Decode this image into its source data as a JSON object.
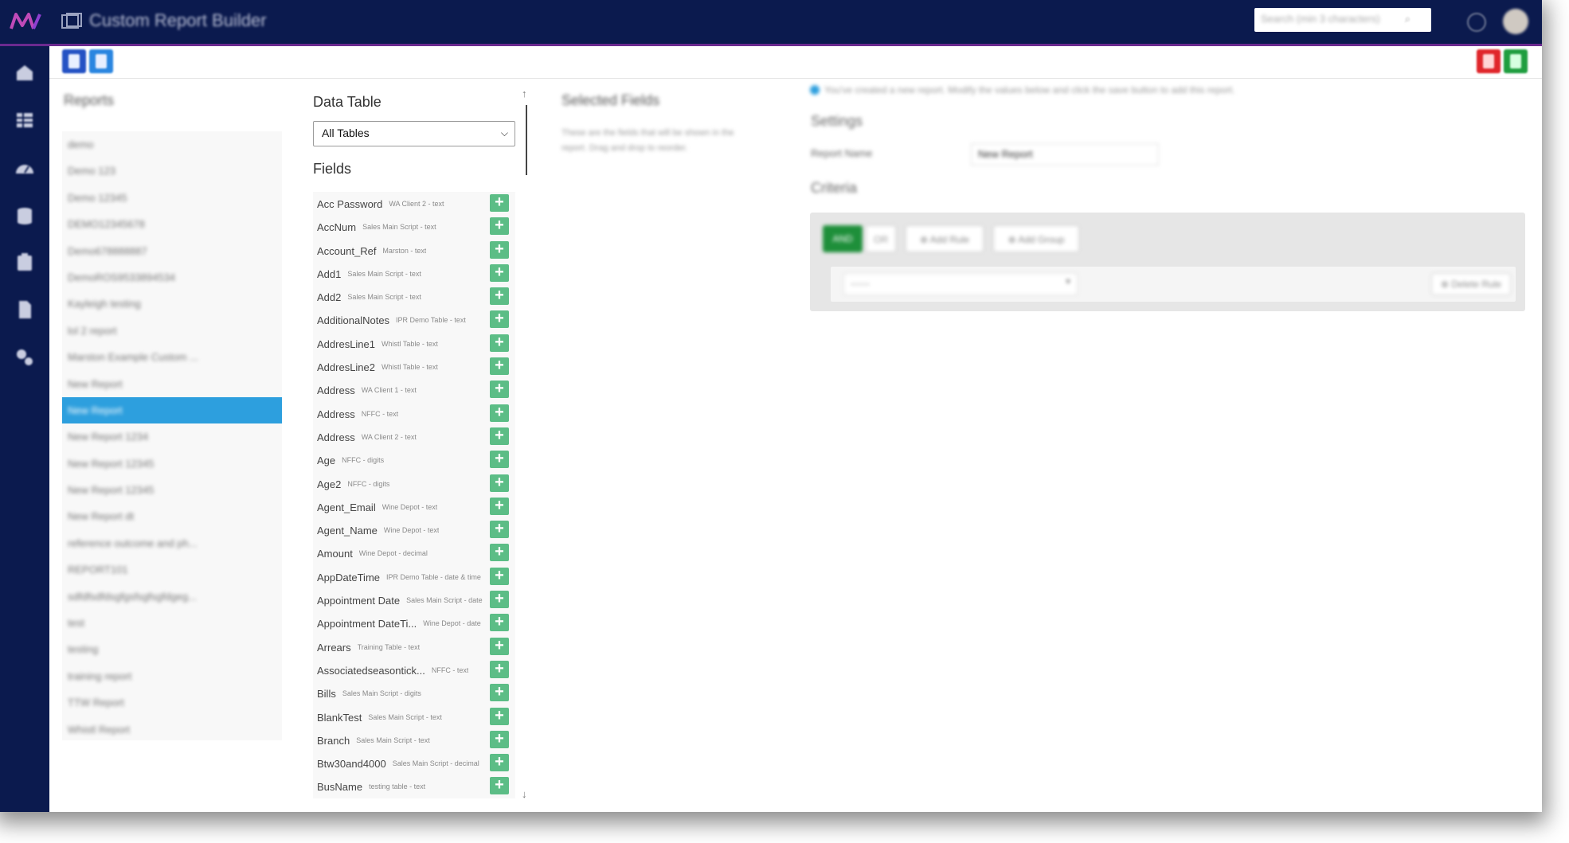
{
  "app": {
    "title": "Custom Report Builder",
    "search_placeholder": "Search (min 3 characters)",
    "search_icon": "⌕"
  },
  "sidebar": {
    "items": [
      {
        "icon": "home-icon"
      },
      {
        "icon": "table-icon"
      },
      {
        "icon": "dashboard-icon"
      },
      {
        "icon": "database-icon"
      },
      {
        "icon": "clipboard-icon"
      },
      {
        "icon": "document-icon"
      },
      {
        "icon": "settings-icon"
      }
    ]
  },
  "toolbar": {
    "new_icon": "new-report-icon",
    "copy_icon": "copy-report-icon",
    "close_icon": "close-icon",
    "save_icon": "save-icon"
  },
  "reports": {
    "title": "Reports",
    "items": [
      "demo",
      "Demo 123",
      "Demo 12345",
      "DEMO12345678",
      "Demo678888887",
      "DemoROS9533894534",
      "Kayleigh testing",
      "lol 2 report",
      "Marston Example Custom ...",
      "New Report",
      "New Report",
      "New Report 1234",
      "New Report 12345",
      "New Report 12345",
      "New Report dt",
      "reference outcome and ph...",
      "REPORT101",
      "sdfdfsdfdsgfgsfsgfsgfdgeg...",
      "test",
      "testing",
      "training report",
      "TTW Report",
      "Whistl Report"
    ],
    "active_index": 10
  },
  "data_table": {
    "title": "Data Table",
    "selected": "All Tables",
    "fields_title": "Fields"
  },
  "fields": [
    {
      "name": "Acc Password",
      "meta": "WA Client 2 - text"
    },
    {
      "name": "AccNum",
      "meta": "Sales Main Script - text"
    },
    {
      "name": "Account_Ref",
      "meta": "Marston - text"
    },
    {
      "name": "Add1",
      "meta": "Sales Main Script - text"
    },
    {
      "name": "Add2",
      "meta": "Sales Main Script - text"
    },
    {
      "name": "AdditionalNotes",
      "meta": "IPR Demo Table - text"
    },
    {
      "name": "AddresLine1",
      "meta": "Whistl Table - text"
    },
    {
      "name": "AddresLine2",
      "meta": "Whistl Table - text"
    },
    {
      "name": "Address",
      "meta": "WA Client 1 - text"
    },
    {
      "name": "Address",
      "meta": "NFFC - text"
    },
    {
      "name": "Address",
      "meta": "WA Client 2 - text"
    },
    {
      "name": "Age",
      "meta": "NFFC - digits"
    },
    {
      "name": "Age2",
      "meta": "NFFC - digits"
    },
    {
      "name": "Agent_Email",
      "meta": "Wine Depot - text"
    },
    {
      "name": "Agent_Name",
      "meta": "Wine Depot - text"
    },
    {
      "name": "Amount",
      "meta": "Wine Depot - decimal"
    },
    {
      "name": "AppDateTime",
      "meta": "IPR Demo Table - date & time"
    },
    {
      "name": "Appointment Date",
      "meta": "Sales Main Script - date"
    },
    {
      "name": "Appointment DateTi...",
      "meta": "Wine Depot - date"
    },
    {
      "name": "Arrears",
      "meta": "Training Table - text"
    },
    {
      "name": "Associatedseasontick...",
      "meta": "NFFC - text"
    },
    {
      "name": "Bills",
      "meta": "Sales Main Script - digits"
    },
    {
      "name": "BlankTest",
      "meta": "Sales Main Script - text"
    },
    {
      "name": "Branch",
      "meta": "Sales Main Script - text"
    },
    {
      "name": "Btw30and4000",
      "meta": "Sales Main Script - decimal"
    },
    {
      "name": "BusName",
      "meta": "testing table - text"
    },
    {
      "name": "",
      "meta": ""
    }
  ],
  "field_add_label": "+",
  "scroll": {
    "up": "↑",
    "down": "↓"
  },
  "selected_fields": {
    "title": "Selected Fields",
    "description": "These are the fields that will be shown in the report. Drag and drop to reorder."
  },
  "notice": "You've created a new report. Modify the values below and click the save button to add this report.",
  "settings": {
    "title": "Settings",
    "report_name_label": "Report Name",
    "report_name_value": "New Report"
  },
  "criteria": {
    "title": "Criteria",
    "and_label": "AND",
    "or_label": "OR",
    "add_rule_label": "⊕ Add Rule",
    "add_group_label": "⊕ Add Group",
    "rule_select_value": "------",
    "delete_rule_label": "⊗ Delete Rule"
  },
  "colors": {
    "topbar": "#0b1a4e",
    "accent": "#6b2a8f",
    "active_row": "#2d9fde",
    "add_button": "#5cbd86",
    "and_button": "#1e8f3a",
    "close_button": "#e0262b",
    "save_button": "#1f9e3f"
  }
}
